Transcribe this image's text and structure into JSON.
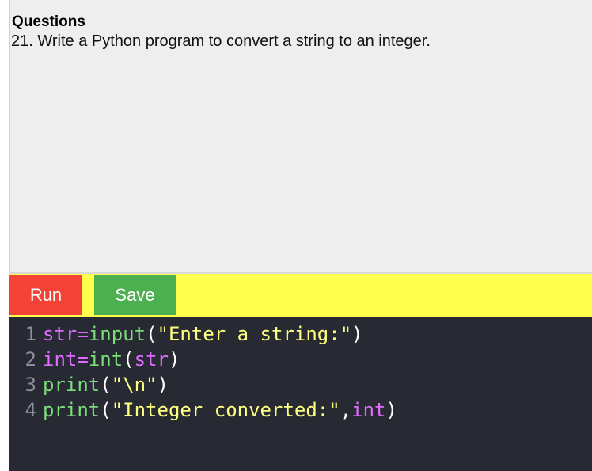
{
  "question": {
    "heading": "Questions",
    "text": "21. Write a Python program to convert a string to an integer."
  },
  "toolbar": {
    "run_label": "Run",
    "save_label": "Save"
  },
  "colors": {
    "run_button": "#f44336",
    "save_button": "#4caf50",
    "toolbar_bg": "#ffff4d",
    "editor_bg": "#272a33",
    "question_bg": "#eeeeee"
  },
  "editor": {
    "lines": [
      {
        "number": "1",
        "tokens": [
          {
            "t": "str",
            "k": "var"
          },
          {
            "t": "=",
            "k": "op"
          },
          {
            "t": "input",
            "k": "fn"
          },
          {
            "t": "(",
            "k": "punc"
          },
          {
            "t": "\"Enter a string:\"",
            "k": "str"
          },
          {
            "t": ")",
            "k": "punc"
          }
        ]
      },
      {
        "number": "2",
        "tokens": [
          {
            "t": "int",
            "k": "var"
          },
          {
            "t": "=",
            "k": "op"
          },
          {
            "t": "int",
            "k": "fn"
          },
          {
            "t": "(",
            "k": "punc"
          },
          {
            "t": "str",
            "k": "var"
          },
          {
            "t": ")",
            "k": "punc"
          }
        ]
      },
      {
        "number": "3",
        "tokens": [
          {
            "t": "print",
            "k": "fn"
          },
          {
            "t": "(",
            "k": "punc"
          },
          {
            "t": "\"\\n\"",
            "k": "str"
          },
          {
            "t": ")",
            "k": "punc"
          }
        ]
      },
      {
        "number": "4",
        "tokens": [
          {
            "t": "print",
            "k": "fn"
          },
          {
            "t": "(",
            "k": "punc"
          },
          {
            "t": "\"Integer converted:\"",
            "k": "str"
          },
          {
            "t": ",",
            "k": "punc"
          },
          {
            "t": "int",
            "k": "var"
          },
          {
            "t": ")",
            "k": "punc"
          }
        ]
      }
    ]
  }
}
